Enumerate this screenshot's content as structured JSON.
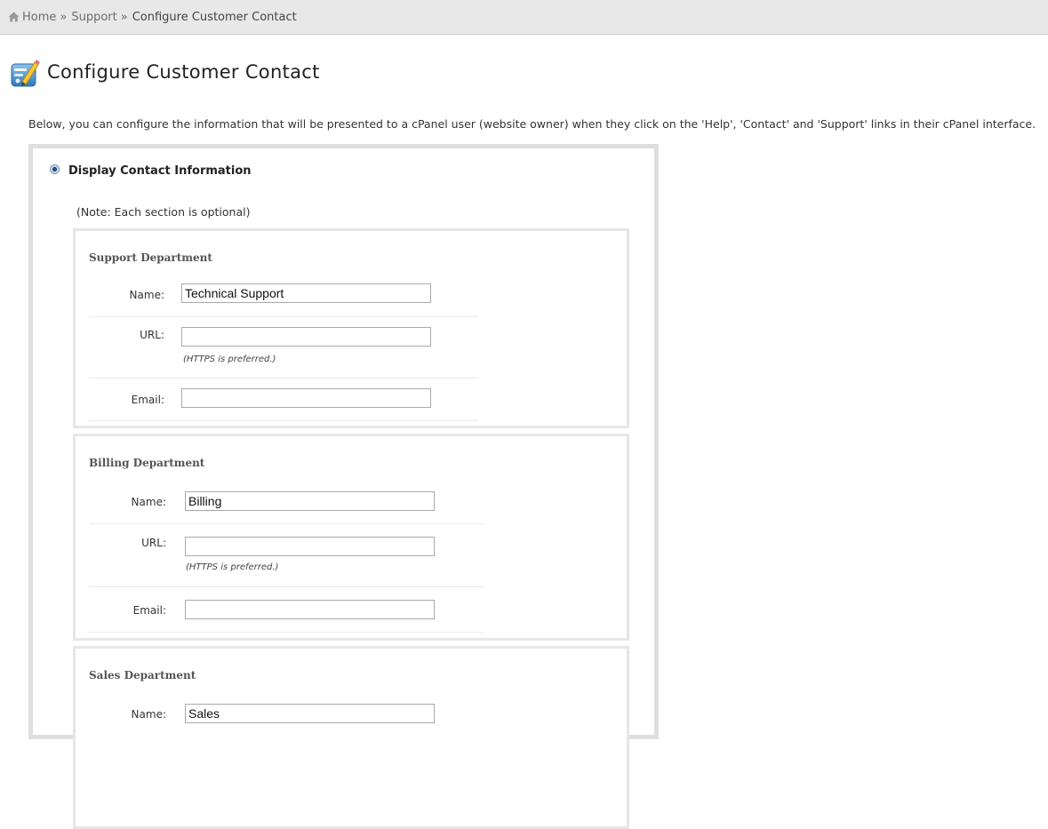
{
  "breadcrumb": {
    "home": "Home",
    "support": "Support",
    "current": "Configure Customer Contact",
    "separator": "»"
  },
  "page": {
    "title": "Configure Customer Contact",
    "intro": "Below, you can configure the information that will be presented to a cPanel user (website owner) when they click on the 'Help', 'Contact' and 'Support' links in their cPanel interface."
  },
  "contact_option": {
    "label": "Display Contact Information",
    "selected": true,
    "note": "(Note: Each section is optional)"
  },
  "labels": {
    "name": "Name:",
    "url": "URL:",
    "email": "Email:",
    "url_hint": "(HTTPS is preferred.)"
  },
  "departments": [
    {
      "title": "Support Department",
      "name": "Technical Support",
      "url": "",
      "email": ""
    },
    {
      "title": "Billing Department",
      "name": "Billing",
      "url": "",
      "email": ""
    },
    {
      "title": "Sales Department",
      "name": "Sales",
      "url": "",
      "email": ""
    }
  ],
  "colors": {
    "breadcrumb_bg": "#e8e8e8",
    "panel_border": "#dedede",
    "section_border": "#e6e6e6"
  },
  "icons": {
    "home": "home-icon",
    "page": "contact-edit-icon"
  }
}
